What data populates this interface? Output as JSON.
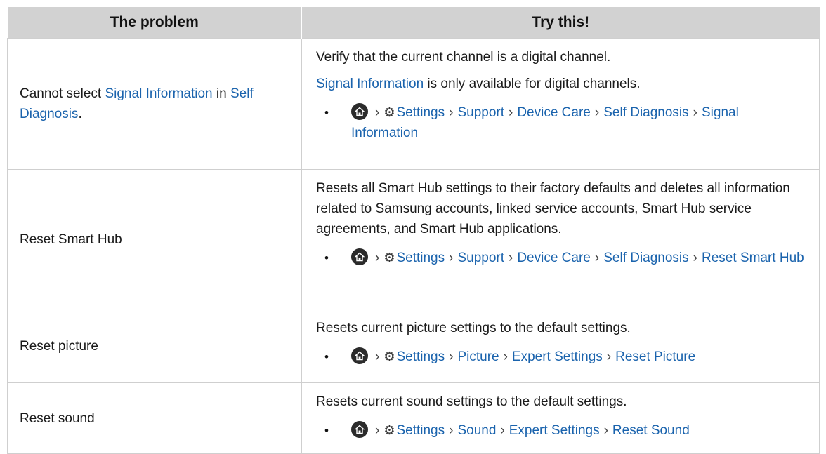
{
  "table": {
    "headers": [
      "The problem",
      "Try this!"
    ],
    "rows": [
      {
        "problem": {
          "t1": "Cannot select ",
          "l1": "Signal Information",
          "t2": " in ",
          "l2": "Self Diagnosis",
          "t3": "."
        },
        "lines": [
          {
            "pre": "",
            "link": "",
            "post": "Verify that the current channel is a digital channel."
          },
          {
            "pre": "",
            "link": "Signal Information",
            "post": " is only available for digital channels."
          }
        ],
        "path": [
          "Settings",
          "Support",
          "Device Care",
          "Self Diagnosis",
          "Signal Information"
        ]
      },
      {
        "problem": "Reset Smart Hub",
        "lines": [
          {
            "pre": "",
            "link": "",
            "post": "Resets all Smart Hub settings to their factory defaults and deletes all information related to Samsung accounts, linked service accounts, Smart Hub service agreements, and Smart Hub applications."
          }
        ],
        "path": [
          "Settings",
          "Support",
          "Device Care",
          "Self Diagnosis",
          "Reset Smart Hub"
        ]
      },
      {
        "problem": "Reset picture",
        "lines": [
          {
            "pre": "",
            "link": "",
            "post": "Resets current picture settings to the default settings."
          }
        ],
        "path": [
          "Settings",
          "Picture",
          "Expert Settings",
          "Reset Picture"
        ]
      },
      {
        "problem": "Reset sound",
        "lines": [
          {
            "pre": "",
            "link": "",
            "post": "Resets current sound settings to the default settings."
          }
        ],
        "path": [
          "Settings",
          "Sound",
          "Expert Settings",
          "Reset Sound"
        ]
      }
    ]
  },
  "symbols": {
    "separator": "›",
    "bullet": "•",
    "gear": "⚙"
  },
  "colors": {
    "link": "#1a63ad",
    "header_bg": "#d2d2d2",
    "border": "#cfcfcf"
  }
}
